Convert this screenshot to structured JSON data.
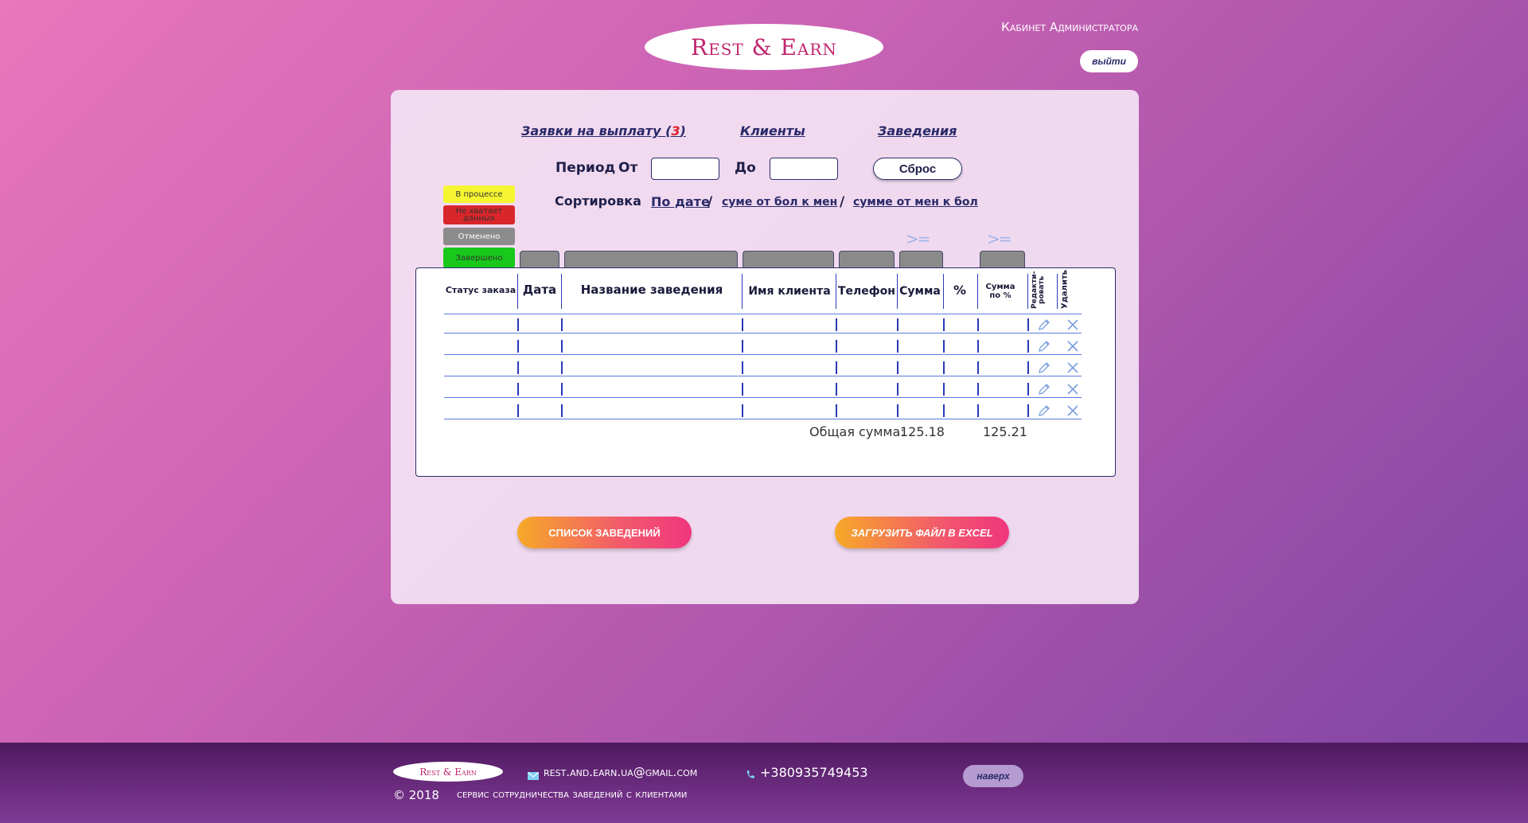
{
  "header": {
    "logo_text": "Rest & Earn",
    "admin_title": "Кабинет Администратора",
    "logout_label": "выйти"
  },
  "nav": {
    "payout_requests_label": "Заявки на выплату (",
    "payout_requests_count": "3",
    "payout_requests_close": ")",
    "clients_label": "Клиенты",
    "venues_label": "Заведения"
  },
  "filters": {
    "period_label": "Период",
    "from_label": "От",
    "to_label": "До",
    "from_value": "",
    "to_value": "",
    "reset_label": "Сброс",
    "sort_label": "Сортировка",
    "sort_by_date": "По дате",
    "sort_desc": "суме от бол к мен",
    "sort_asc": "сумме от мен к бол",
    "sort_separator": "/",
    "gte_symbol": ">="
  },
  "legend": [
    {
      "label": "В процессе",
      "color": "#f5f531"
    },
    {
      "label": "Не хватает данных",
      "color": "#d9262b"
    },
    {
      "label": "Отменено",
      "color": "#8c8c8c"
    },
    {
      "label": "Завершено",
      "color": "#18c81a"
    }
  ],
  "table": {
    "columns": [
      "Статус заказа",
      "Дата",
      "Название заведения",
      "Имя клиента",
      "Телефон",
      "Сумма",
      "%",
      "Сумма по %",
      "Редакти-ровать",
      "Удалить"
    ],
    "rows": [
      [
        "",
        "",
        "",
        "",
        "",
        "",
        "",
        ""
      ],
      [
        "",
        "",
        "",
        "",
        "",
        "",
        "",
        ""
      ],
      [
        "",
        "",
        "",
        "",
        "",
        "",
        "",
        ""
      ],
      [
        "",
        "",
        "",
        "",
        "",
        "",
        "",
        ""
      ],
      [
        "",
        "",
        "",
        "",
        "",
        "",
        "",
        ""
      ]
    ],
    "total_label": "Общая сумма:",
    "total_sum": "125.18",
    "total_sum_percent": "125.21"
  },
  "actions": {
    "venues_list_label": "СПИСОК ЗАВЕДЕНИЙ",
    "upload_excel_label": "ЗАГРУЗИТЬ ФАЙЛ В EXCEL"
  },
  "footer": {
    "logo_text": "Rest & Earn",
    "email": "rest.and.earn.ua@gmail.com",
    "phone": "+380935749453",
    "copyright": "© 2018",
    "tagline": "сервис сотрудничества заведений с клиентами",
    "to_top_label": "наверх"
  },
  "colors": {
    "accent": "#c0266e",
    "link": "#2a2a6a",
    "count_red": "#e0202a"
  }
}
